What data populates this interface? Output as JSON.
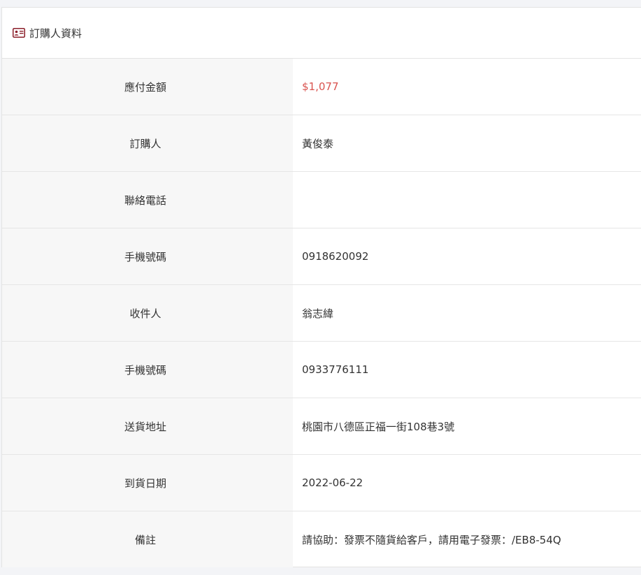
{
  "section": {
    "title": "訂購人資料",
    "icon": "id-card-icon",
    "icon_color": "#8b1f2a"
  },
  "rows": [
    {
      "label": "應付金額",
      "value": "$1,077"
    },
    {
      "label": "訂購人",
      "value": "黃俊泰"
    },
    {
      "label": "聯絡電話",
      "value": ""
    },
    {
      "label": "手機號碼",
      "value": "0918620092"
    },
    {
      "label": "收件人",
      "value": "翁志緯"
    },
    {
      "label": "手機號碼",
      "value": "0933776111"
    },
    {
      "label": "送貨地址",
      "value": "桃園市八德區正福一街108巷3號"
    },
    {
      "label": "到貨日期",
      "value": "2022-06-22"
    },
    {
      "label": "備註",
      "value": "請協助：發票不隨貨給客戶，請用電子發票：/EB8-54Q"
    }
  ],
  "colors": {
    "price": "#d9534f",
    "label_bg": "#f7f7f7"
  }
}
